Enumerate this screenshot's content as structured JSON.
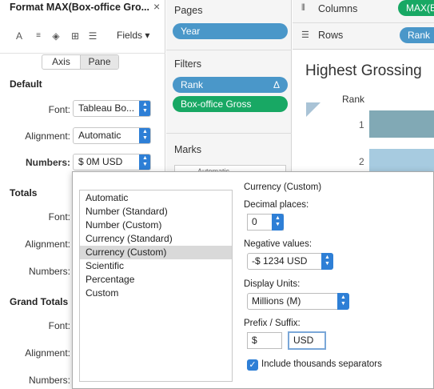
{
  "format_pane": {
    "title": "Format MAX(Box-office Gro...",
    "close_glyph": "×",
    "toolbar": {
      "fields_label": "Fields ▾"
    },
    "tabs": [
      "Axis",
      "Pane"
    ],
    "sections": {
      "default": "Default",
      "totals": "Totals",
      "grand_totals": "Grand Totals"
    },
    "labels": {
      "font": "Font:",
      "alignment": "Alignment:",
      "numbers": "Numbers:"
    },
    "default_values": {
      "font": "Tableau Bo...",
      "alignment": "Automatic",
      "numbers": "$ 0M USD"
    }
  },
  "shelves": {
    "pages_title": "Pages",
    "pages_pill": "Year",
    "filters_title": "Filters",
    "filters_pills": [
      "Rank",
      "Box-office Gross"
    ],
    "rank_delta": "Δ",
    "marks_title": "Marks",
    "marks_partial": "Automatic"
  },
  "top_shelves": {
    "columns_label": "Columns",
    "columns_pill": "MAX(B",
    "rows_label": "Rows",
    "rows_pill": "Rank"
  },
  "viz": {
    "title": "Highest Grossing",
    "rank_header": "Rank",
    "ranks": [
      "1",
      "2"
    ]
  },
  "number_format_popup": {
    "formats": [
      "Automatic",
      "Number (Standard)",
      "Number (Custom)",
      "Currency (Standard)",
      "Currency (Custom)",
      "Scientific",
      "Percentage",
      "Custom"
    ],
    "selected_index": 4,
    "heading": "Currency (Custom)",
    "decimal_places_label": "Decimal places:",
    "decimal_places_value": "0",
    "negative_values_label": "Negative values:",
    "negative_values_value": "-$ 1234 USD",
    "display_units_label": "Display Units:",
    "display_units_value": "Millions (M)",
    "prefix_suffix_label": "Prefix / Suffix:",
    "prefix_value": "$",
    "suffix_value": "USD",
    "thousands_label": "Include thousands separators",
    "thousands_checked": true
  },
  "colors": {
    "accent_blue": "#2e7fd6",
    "pill_blue": "#4a97c9",
    "pill_green": "#18a864"
  }
}
